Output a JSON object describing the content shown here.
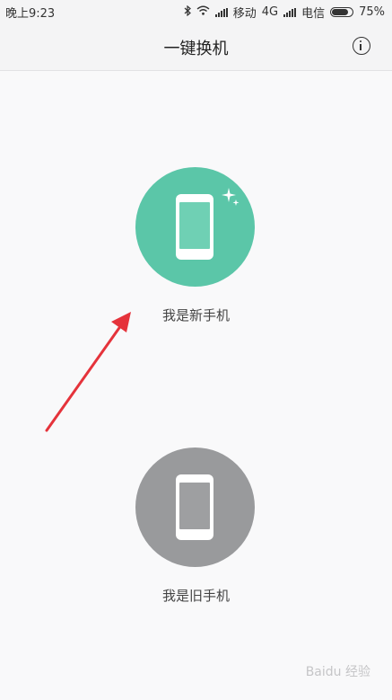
{
  "status_bar": {
    "time": "晚上9:23",
    "carrier1": "移动",
    "network": "4G",
    "carrier2": "电信",
    "battery_text": "75%",
    "battery_level": 0.75
  },
  "header": {
    "title": "一键换机",
    "info_icon": "info-icon"
  },
  "options": {
    "new_phone": {
      "label": "我是新手机",
      "color": "#5bc6a8",
      "icon": "smartphone-icon"
    },
    "old_phone": {
      "label": "我是旧手机",
      "color": "#999a9c",
      "icon": "smartphone-icon"
    }
  },
  "annotation": {
    "arrow_color": "#e5333b"
  },
  "watermark": {
    "text": "Baidu 经验"
  }
}
